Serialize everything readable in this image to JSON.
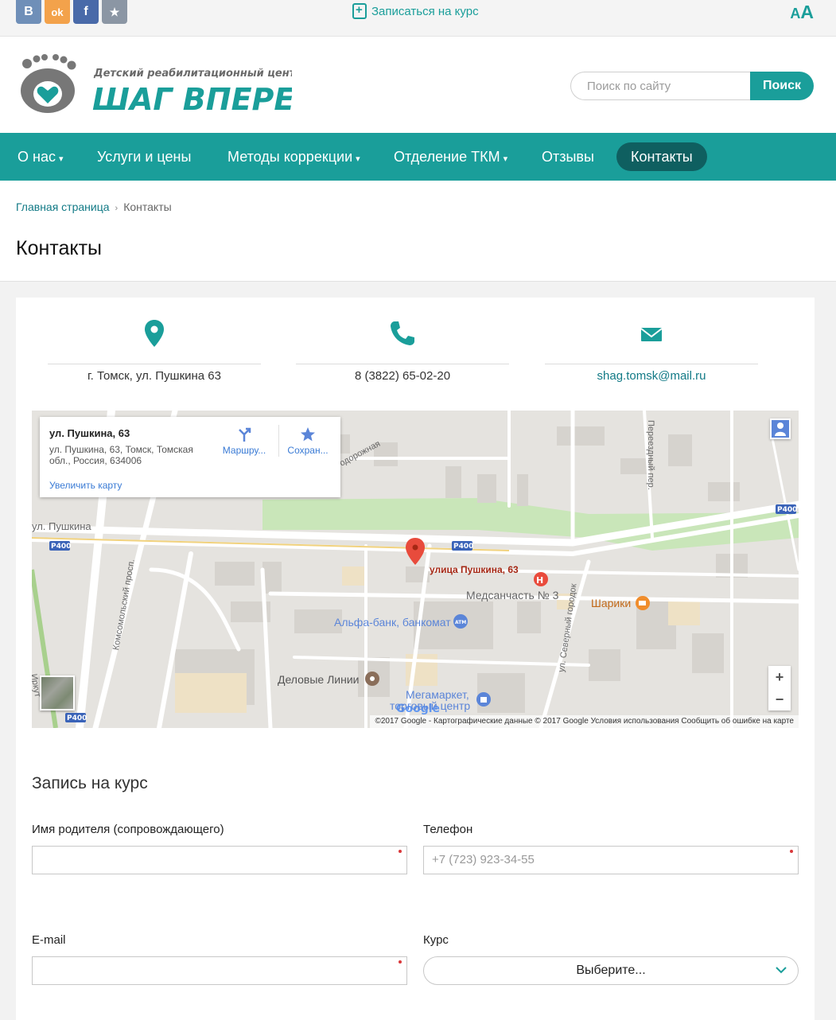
{
  "topbar": {
    "social": [
      {
        "name": "vk",
        "label": "В",
        "color": "#6f8fb8"
      },
      {
        "name": "ok",
        "label": "ok",
        "color": "#f3a24b"
      },
      {
        "name": "facebook",
        "label": "f",
        "color": "#496aa9"
      },
      {
        "name": "favorite",
        "label": "★",
        "color": "#8b96a4"
      }
    ],
    "enroll_label": "Записаться на курс",
    "font_small": "A",
    "font_big": "A"
  },
  "header": {
    "logo_subtitle": "Детский реабилитационный центр",
    "logo_title": "ШАГ ВПЕРЕД",
    "search_placeholder": "Поиск по сайту",
    "search_button": "Поиск"
  },
  "nav": {
    "items": [
      {
        "label": "О нас",
        "dropdown": true
      },
      {
        "label": "Услуги и цены",
        "dropdown": false
      },
      {
        "label": "Методы коррекции",
        "dropdown": true
      },
      {
        "label": "Отделение ТКМ",
        "dropdown": true
      },
      {
        "label": "Отзывы",
        "dropdown": false
      },
      {
        "label": "Контакты",
        "dropdown": false,
        "active": true
      }
    ],
    "caret": "▾"
  },
  "breadcrumb": {
    "home": "Главная страница",
    "sep": "›",
    "current": "Контакты"
  },
  "page_title": "Контакты",
  "contacts": {
    "address": "г. Томск, ул. Пушкина 63",
    "phone": "8 (3822) 65-02-20",
    "email": "shag.tomsk@mail.ru"
  },
  "map": {
    "info_title": "ул. Пушкина, 63",
    "info_address": "ул. Пушкина, 63, Томск, Томская обл., Россия, 634006",
    "info_directions": "Маршру...",
    "info_save": "Сохран...",
    "info_zoom": "Увеличить карту",
    "labels": {
      "street_pushkina": "ул. Пушкина",
      "pin_label": "улица Пушкина, 63",
      "medsanchast": "Медсанчасть № 3",
      "alfa": "Альфа-банк, банкомат",
      "delovye": "Деловые Линии",
      "megamarket_1": "Мегамаркет,",
      "megamarket_2": "торговый центр",
      "shariki": "Шарики",
      "komsomolsky": "Комсомольский просп.",
      "severny": "ул. Северный городок",
      "pereezdny": "Переездный пер.",
      "dorozhnaya": "одорожная",
      "irkut": "Иркут",
      "r400": "P400",
      "atm": "ATM",
      "hospital": "H",
      "google": "Google"
    },
    "zoom_in": "+",
    "zoom_out": "−",
    "footer": "©2017 Google - Картографические данные © 2017 Google     Условия использования     Сообщить об ошибке на карте"
  },
  "form": {
    "title": "Запись на курс",
    "parent_label": "Имя родителя (сопровождающего)",
    "phone_label": "Телефон",
    "phone_placeholder": "+7 (723) 923-34-55",
    "email_label": "E-mail",
    "course_label": "Курс",
    "course_value": "Выберите..."
  }
}
